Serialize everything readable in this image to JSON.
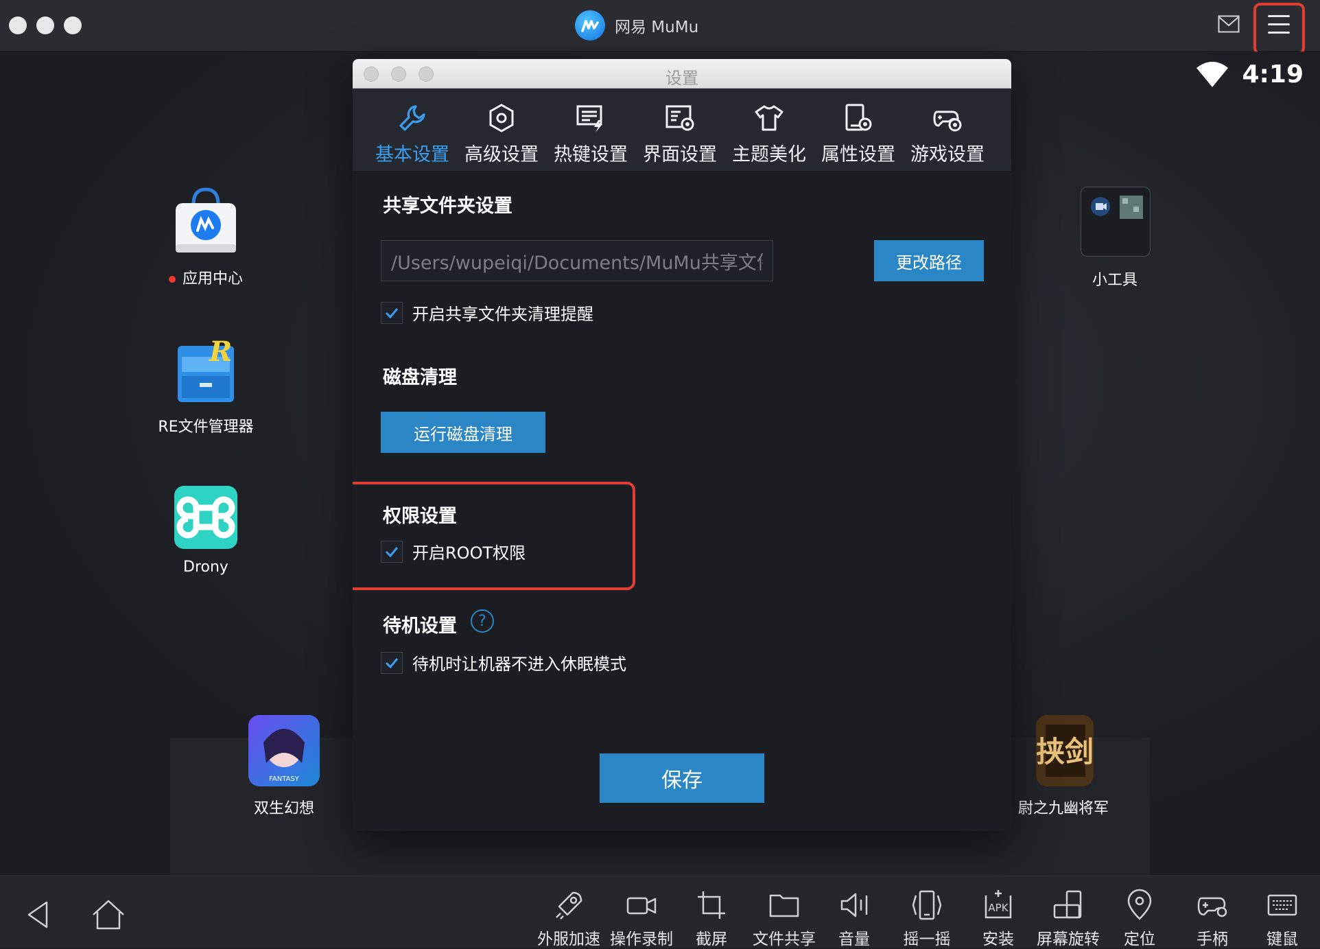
{
  "window": {
    "title": "网易 MuMu"
  },
  "status": {
    "clock": "4:19"
  },
  "desktop": {
    "icons": [
      {
        "label": "应用中心"
      },
      {
        "label": "RE文件管理器"
      },
      {
        "label": "Drony"
      },
      {
        "label": "小工具"
      }
    ],
    "games": [
      {
        "label": "双生幻想"
      },
      {
        "label": "尉之九幽将军"
      }
    ],
    "game_icon_text": {
      "right": "挟剑",
      "left": "FANTASY"
    }
  },
  "settings": {
    "title": "设置",
    "tabs": [
      {
        "label": "基本设置",
        "active": true
      },
      {
        "label": "高级设置"
      },
      {
        "label": "热键设置"
      },
      {
        "label": "界面设置"
      },
      {
        "label": "主题美化"
      },
      {
        "label": "属性设置"
      },
      {
        "label": "游戏设置"
      }
    ],
    "shared_folder": {
      "title": "共享文件夹设置",
      "path": "/Users/wupeiqi/Documents/MuMu共享文件夹",
      "change_button": "更改路径",
      "cleanup_reminder": "开启共享文件夹清理提醒"
    },
    "disk": {
      "title": "磁盘清理",
      "button": "运行磁盘清理"
    },
    "permission": {
      "title": "权限设置",
      "root": "开启ROOT权限"
    },
    "standby": {
      "title": "待机设置",
      "help": "?",
      "no_sleep": "待机时让机器不进入休眠模式"
    },
    "save_button": "保存"
  },
  "toolbar": {
    "items": [
      {
        "label": "外服加速",
        "icon": "rocket-icon"
      },
      {
        "label": "操作录制",
        "icon": "video-camera-icon"
      },
      {
        "label": "截屏",
        "icon": "crop-icon"
      },
      {
        "label": "文件共享",
        "icon": "folder-icon"
      },
      {
        "label": "音量",
        "icon": "volume-icon"
      },
      {
        "label": "摇一摇",
        "icon": "shake-icon"
      },
      {
        "label": "安装",
        "icon": "apk-icon",
        "icon_text": "APK"
      },
      {
        "label": "屏幕旋转",
        "icon": "rotate-screen-icon"
      },
      {
        "label": "定位",
        "icon": "location-icon"
      },
      {
        "label": "手柄",
        "icon": "gamepad-icon"
      },
      {
        "label": "键鼠",
        "icon": "keyboard-icon"
      }
    ]
  },
  "colors": {
    "accent": "#2a86c4",
    "active_tab": "#3a9ef0",
    "highlight": "#e03c31"
  }
}
